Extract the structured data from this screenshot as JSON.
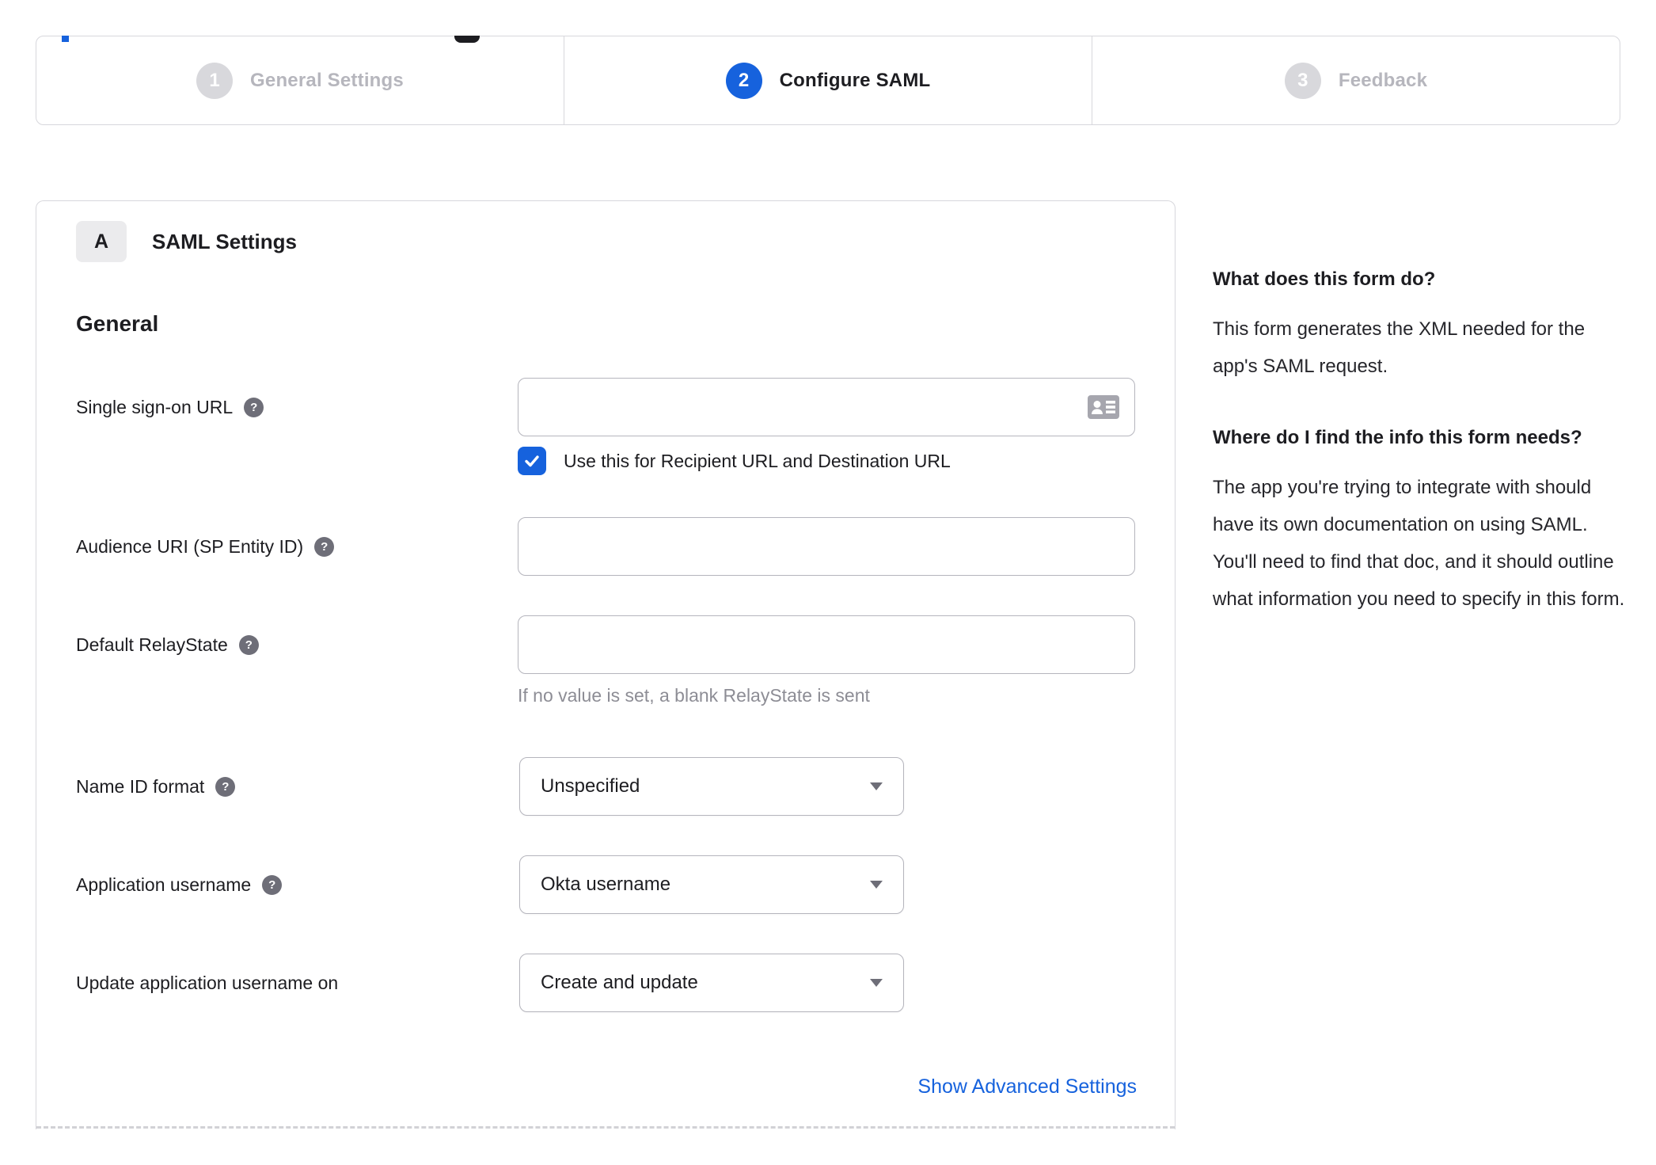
{
  "colors": {
    "accent_blue": "#1662dd",
    "inactive_gray": "#d8d8dc",
    "border_gray": "#d7d7dc",
    "help_icon_gray": "#6e6e78",
    "hint_gray": "#8d8d95"
  },
  "icons": {
    "help_glyph": "?"
  },
  "stepper": {
    "steps": [
      {
        "number": "1",
        "label": "General Settings",
        "state": "inactive"
      },
      {
        "number": "2",
        "label": "Configure SAML",
        "state": "active"
      },
      {
        "number": "3",
        "label": "Feedback",
        "state": "inactive"
      }
    ]
  },
  "panel": {
    "section_letter": "A",
    "section_title": "SAML Settings",
    "subsection_title": "General",
    "fields": [
      {
        "label": "Single sign-on URL",
        "type": "text",
        "value": "",
        "checkbox": {
          "checked": true,
          "label": "Use this for Recipient URL and Destination URL"
        }
      },
      {
        "label": "Audience URI (SP Entity ID)",
        "type": "text",
        "value": ""
      },
      {
        "label": "Default RelayState",
        "type": "text",
        "value": "",
        "hint": "If no value is set, a blank RelayState is sent"
      },
      {
        "label": "Name ID format",
        "type": "select",
        "value": "Unspecified"
      },
      {
        "label": "Application username",
        "type": "select",
        "value": "Okta username"
      },
      {
        "label": "Update application username on",
        "type": "select",
        "value": "Create and update"
      }
    ],
    "advanced_link": "Show Advanced Settings"
  },
  "help": {
    "sections": [
      {
        "heading": "What does this form do?",
        "body": "This form generates the XML needed for the app's SAML request."
      },
      {
        "heading": "Where do I find the info this form needs?",
        "body": "The app you're trying to integrate with should have its own documentation on using SAML. You'll need to find that doc, and it should outline what information you need to specify in this form."
      }
    ]
  }
}
